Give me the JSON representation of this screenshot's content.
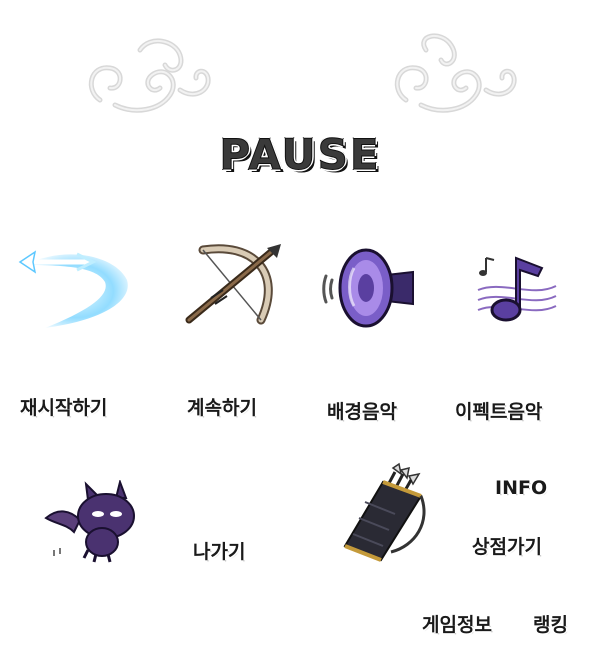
{
  "title": "PAUSE",
  "menu": {
    "restart": "재시작하기",
    "continue": "계속하기",
    "bgm": "배경음악",
    "effect_sound": "이펙트음악",
    "exit": "나가기",
    "info": "INFO",
    "shop": "상점가기",
    "game_info": "게임정보",
    "ranking": "랭킹"
  },
  "icons": {
    "restart": "glowing-arrow-icon",
    "continue": "bow-and-arrow-icon",
    "bgm": "speaker-icon",
    "effect_sound": "music-note-icon",
    "exit": "purple-bat-cat-icon",
    "shop": "quiver-icon"
  },
  "colors": {
    "accent_purple": "#6a4fb3",
    "glow_blue": "#5ec8ff",
    "text": "#1a1a1a"
  }
}
